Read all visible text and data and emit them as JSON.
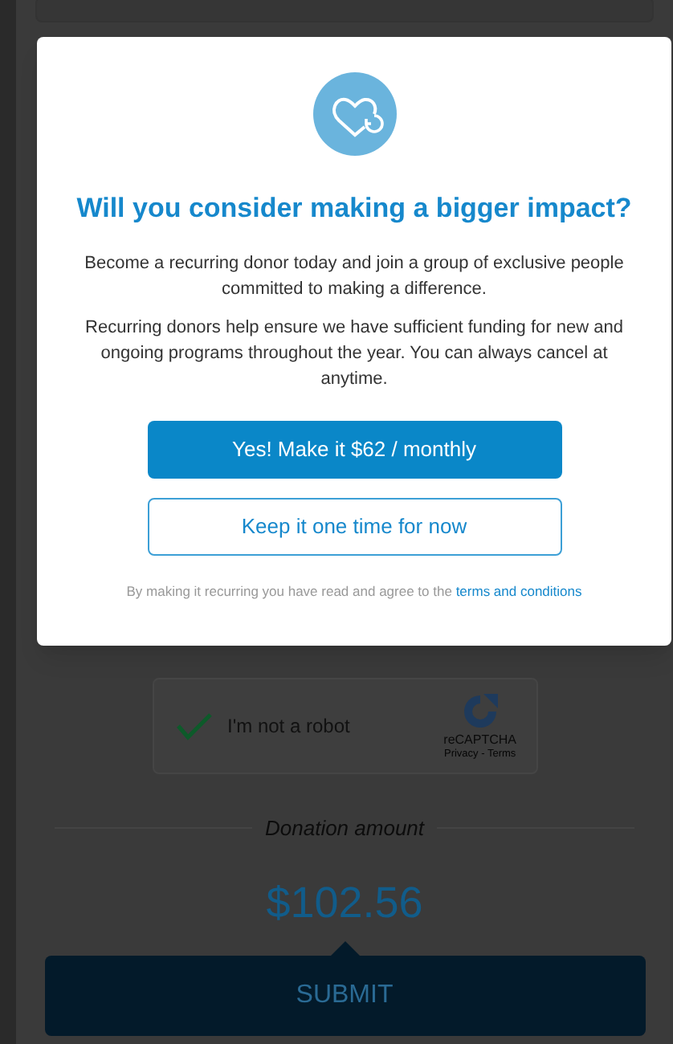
{
  "modal": {
    "title": "Will you consider making a bigger impact?",
    "paragraphs": [
      "Become a recurring donor today and join a group of exclusive people committed to making a difference.",
      "Recurring donors help ensure we have sufficient funding for new and ongoing programs throughout the year. You can always cancel at anytime."
    ],
    "primary_button": "Yes! Make it $62 / monthly",
    "secondary_button": "Keep it one time for now",
    "footnote": {
      "text": "By making it recurring you have read and agree to the",
      "link": "terms and conditions"
    }
  },
  "background": {
    "captcha": {
      "label": "I'm not a robot",
      "checked": true,
      "brand": "reCAPTCHA",
      "links": "Privacy - Terms"
    },
    "amount_label": "Donation amount",
    "amount": "$102.56",
    "submit": "SUBMIT"
  }
}
